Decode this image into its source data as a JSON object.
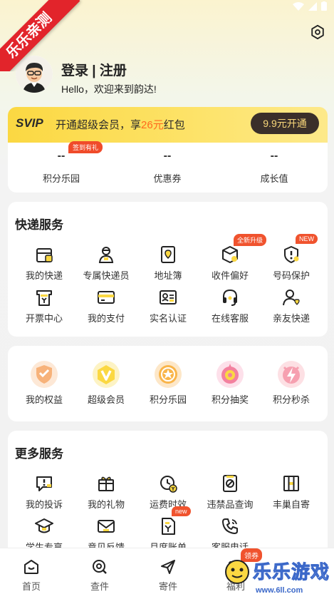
{
  "corner_banner": "乐乐亲测",
  "profile": {
    "login_label": "登录 | 注册",
    "welcome": "Hello，欢迎来到韵达!"
  },
  "svip": {
    "tag": "SVIP",
    "text_before": "开通超级会员，享",
    "highlight": "26元",
    "text_after": "红包",
    "button": "9.9元开通"
  },
  "stats": [
    {
      "value": "--",
      "label": "积分乐园",
      "badge": "签到有礼"
    },
    {
      "value": "--",
      "label": "优惠券"
    },
    {
      "value": "--",
      "label": "成长值"
    }
  ],
  "express": {
    "title": "快递服务",
    "items": [
      {
        "label": "我的快递",
        "icon": "package-icon"
      },
      {
        "label": "专属快递员",
        "icon": "courier-icon"
      },
      {
        "label": "地址簿",
        "icon": "address-book-icon"
      },
      {
        "label": "收件偏好",
        "icon": "preference-icon",
        "badge": "全新升级"
      },
      {
        "label": "号码保护",
        "icon": "shield-icon",
        "badge": "NEW"
      },
      {
        "label": "开票中心",
        "icon": "invoice-icon"
      },
      {
        "label": "我的支付",
        "icon": "card-icon"
      },
      {
        "label": "实名认证",
        "icon": "id-card-icon"
      },
      {
        "label": "在线客服",
        "icon": "headset-icon"
      },
      {
        "label": "亲友快递",
        "icon": "friends-icon"
      }
    ]
  },
  "benefits": {
    "items": [
      {
        "label": "我的权益",
        "icon": "rights-icon"
      },
      {
        "label": "超级会员",
        "icon": "vip-icon"
      },
      {
        "label": "积分乐园",
        "icon": "points-icon"
      },
      {
        "label": "积分抽奖",
        "icon": "lottery-icon"
      },
      {
        "label": "积分秒杀",
        "icon": "flash-sale-icon"
      }
    ]
  },
  "more": {
    "title": "更多服务",
    "items": [
      {
        "label": "我的投诉",
        "icon": "complaint-icon"
      },
      {
        "label": "我的礼物",
        "icon": "gift-icon"
      },
      {
        "label": "运费时效",
        "icon": "fee-time-icon"
      },
      {
        "label": "违禁品查询",
        "icon": "prohibited-icon"
      },
      {
        "label": "丰巢自寄",
        "icon": "locker-icon"
      },
      {
        "label": "学生专享",
        "icon": "graduation-icon"
      },
      {
        "label": "意见反馈",
        "icon": "feedback-icon"
      },
      {
        "label": "月度账单",
        "icon": "bill-icon",
        "badge": "new"
      },
      {
        "label": "客服电话",
        "icon": "phone-icon"
      }
    ]
  },
  "tabbar": [
    {
      "label": "首页",
      "icon": "home-icon"
    },
    {
      "label": "查件",
      "icon": "search-icon"
    },
    {
      "label": "寄件",
      "icon": "send-icon"
    },
    {
      "label": "福利",
      "icon": "welfare-icon",
      "badge": "领券"
    }
  ],
  "watermark": {
    "text": "乐乐游戏",
    "url": "www.6ll.com"
  },
  "colors": {
    "accent_yellow": "#fbd842",
    "badge_red": "#f0532e",
    "dark_button": "#3a2f2a",
    "highlight_orange": "#ff6a1e"
  }
}
